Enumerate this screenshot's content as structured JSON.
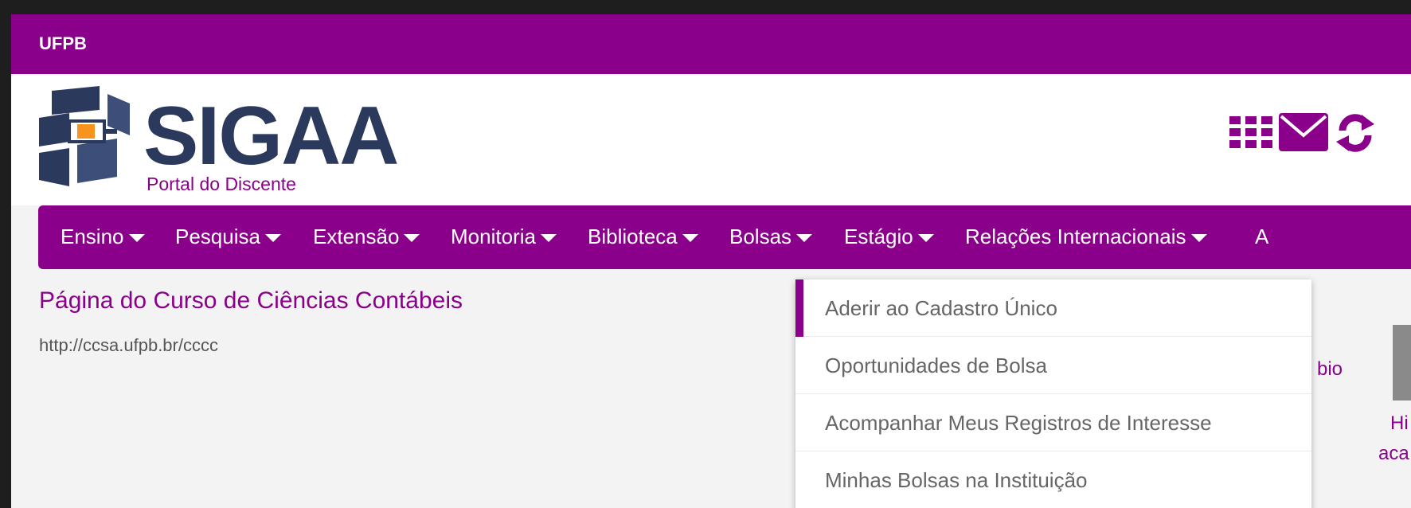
{
  "top_bar": {
    "brand": "UFPB"
  },
  "header": {
    "logo_text": "SIGAA",
    "logo_subtitle": "Portal do Discente",
    "icons": [
      "apps-grid-icon",
      "mail-icon",
      "refresh-icon"
    ]
  },
  "nav": {
    "items": [
      {
        "label": "Ensino"
      },
      {
        "label": "Pesquisa"
      },
      {
        "label": "Extensão"
      },
      {
        "label": "Monitoria"
      },
      {
        "label": "Biblioteca"
      },
      {
        "label": "Bolsas"
      },
      {
        "label": "Estágio"
      },
      {
        "label": "Relações Internacionais"
      },
      {
        "label": "A"
      }
    ]
  },
  "content": {
    "course_link": "Página do Curso de Ciências Contábeis",
    "course_url": "http://ccsa.ufpb.br/cccc",
    "fragments": [
      "bio",
      "Hi",
      "aca"
    ]
  },
  "dropdown": {
    "items": [
      {
        "label": "Aderir ao Cadastro Único"
      },
      {
        "label": "Oportunidades de Bolsa"
      },
      {
        "label": "Acompanhar Meus Registros de Interesse"
      },
      {
        "label": "Minhas Bolsas na Instituição"
      }
    ]
  },
  "colors": {
    "brand_purple": "#8b008b",
    "logo_navy": "#2b3a5c",
    "logo_orange": "#f7941d"
  }
}
